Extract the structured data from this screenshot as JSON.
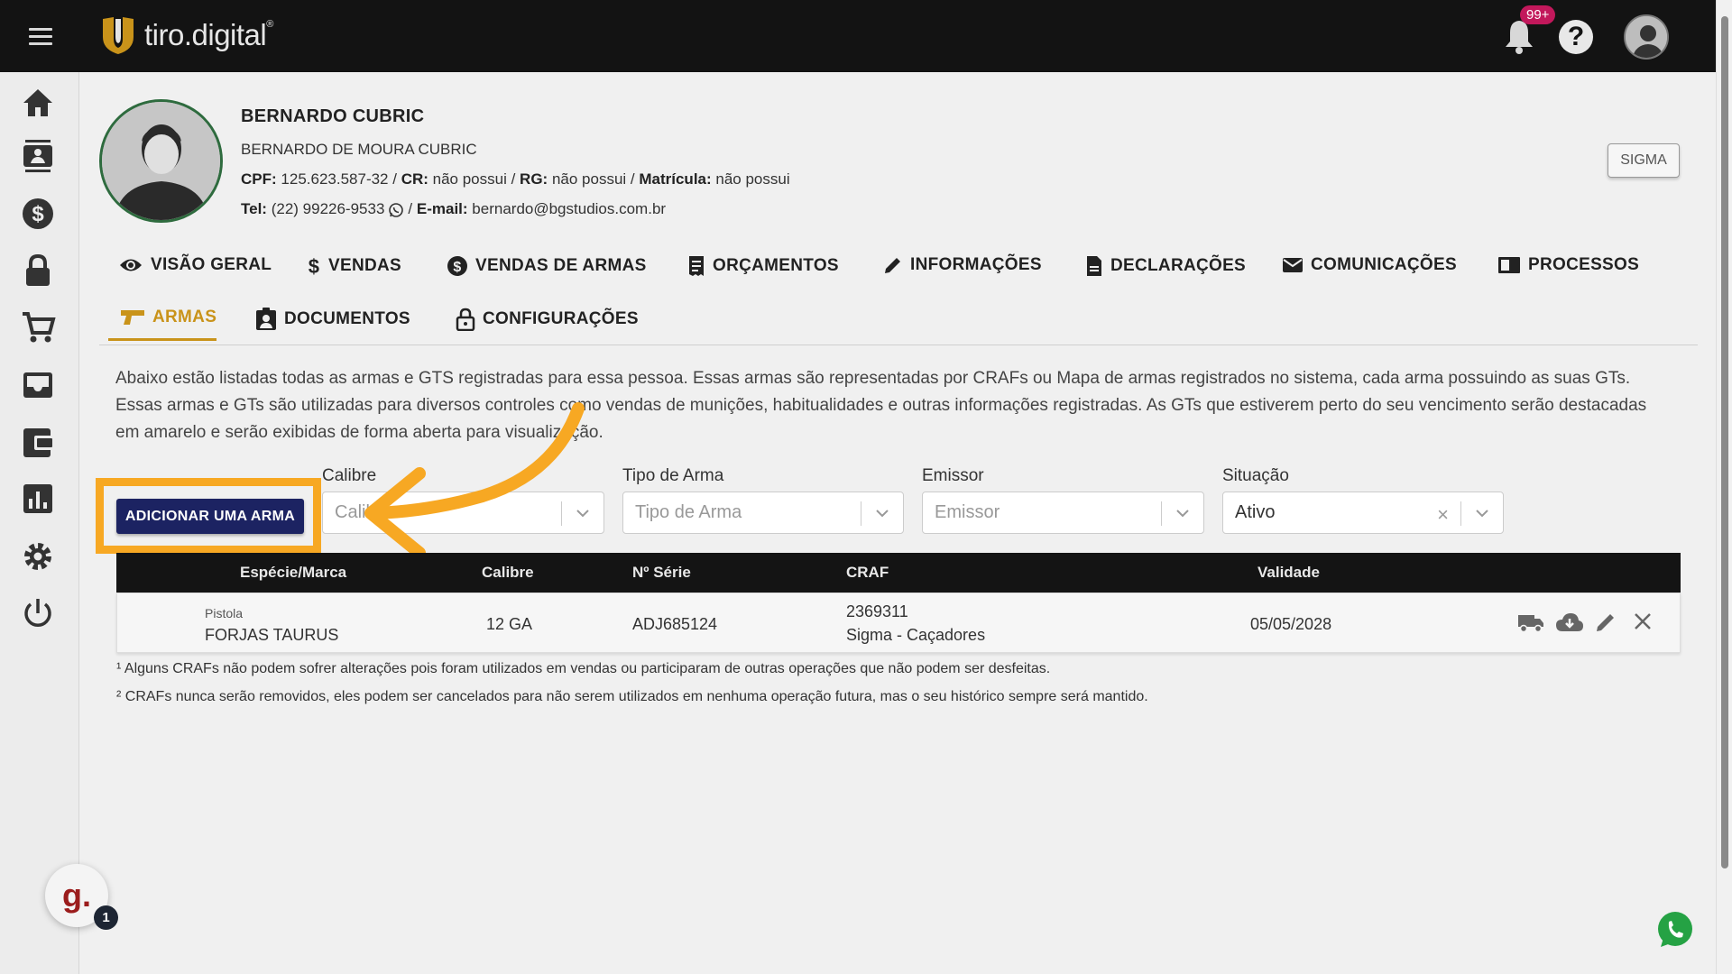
{
  "app": {
    "logo_text": "tiro.digital",
    "logo_reg": "®",
    "notification_count": "99+",
    "help_label": "?"
  },
  "profile": {
    "name": "BERNARDO CUBRIC",
    "full_name": "BERNARDO DE MOURA CUBRIC",
    "cpf_label": "CPF:",
    "cpf": "125.623.587-32",
    "cr_label": "CR:",
    "cr": "não possui",
    "rg_label": "RG:",
    "rg": "não possui",
    "matricula_label": "Matrícula:",
    "matricula": "não possui",
    "tel_label": "Tel:",
    "tel": "(22) 99226-9533",
    "email_label": "E-mail:",
    "email": "bernardo@bgstudios.com.br",
    "sigma_button": "SIGMA"
  },
  "tabs": [
    {
      "label": "VISÃO GERAL",
      "icon": "eye-icon"
    },
    {
      "label": "VENDAS",
      "icon": "dollar-icon"
    },
    {
      "label": "VENDAS DE ARMAS",
      "icon": "dollar-circle-icon"
    },
    {
      "label": "ORÇAMENTOS",
      "icon": "receipt-icon"
    },
    {
      "label": "INFORMAÇÕES",
      "icon": "pencil-icon"
    },
    {
      "label": "DECLARAÇÕES",
      "icon": "document-icon"
    },
    {
      "label": "COMUNICAÇÕES",
      "icon": "mail-icon"
    },
    {
      "label": "PROCESSOS",
      "icon": "folder-icon"
    },
    {
      "label": "ARMAS",
      "icon": "gun-icon",
      "active": true
    },
    {
      "label": "DOCUMENTOS",
      "icon": "badge-icon"
    },
    {
      "label": "CONFIGURAÇÕES",
      "icon": "lock-icon"
    }
  ],
  "description": "Abaixo estão listadas todas as armas e GTS registradas para essa pessoa. Essas armas são representadas por CRAFs ou Mapa de armas registrados no sistema, cada arma possuindo as suas GTs. Essas armas e GTs são utilizadas para diversos controles como vendas de munições, habitualidades e outras informações registradas. As GTs que estiverem perto do seu vencimento serão destacadas em amarelo e serão exibidas de forma aberta para visualização.",
  "filters": {
    "add_button": "ADICIONAR UMA ARMA",
    "calibre_label": "Calibre",
    "calibre_placeholder": "Calibre",
    "tipo_label": "Tipo de Arma",
    "tipo_placeholder": "Tipo de Arma",
    "emissor_label": "Emissor",
    "emissor_placeholder": "Emissor",
    "situacao_label": "Situação",
    "situacao_value": "Ativo"
  },
  "table": {
    "headers": [
      "Espécie/Marca",
      "Calibre",
      "Nº Série",
      "CRAF",
      "Validade"
    ],
    "rows": [
      {
        "especie": "Pistola",
        "marca": "FORJAS TAURUS",
        "calibre": "12 GA",
        "serie": "ADJ685124",
        "craf_num": "2369311",
        "craf_tipo": "Sigma - Caçadores",
        "validade": "05/05/2028"
      }
    ]
  },
  "footnotes": [
    "¹ Alguns CRAFs não podem sofrer alterações pois foram utilizados em vendas ou participaram de outras operações que não podem ser desfeitas.",
    "² CRAFs nunca serão removidos, eles podem ser cancelados para não serem utilizados em nenhuma operação futura, mas o seu histórico sempre será mantido."
  ],
  "widgets": {
    "g_label": "g.",
    "g_badge": "1"
  },
  "colors": {
    "accent": "#c9931a",
    "primary_button": "#1c2362",
    "highlight": "#f7a823",
    "topbar": "#131313"
  }
}
